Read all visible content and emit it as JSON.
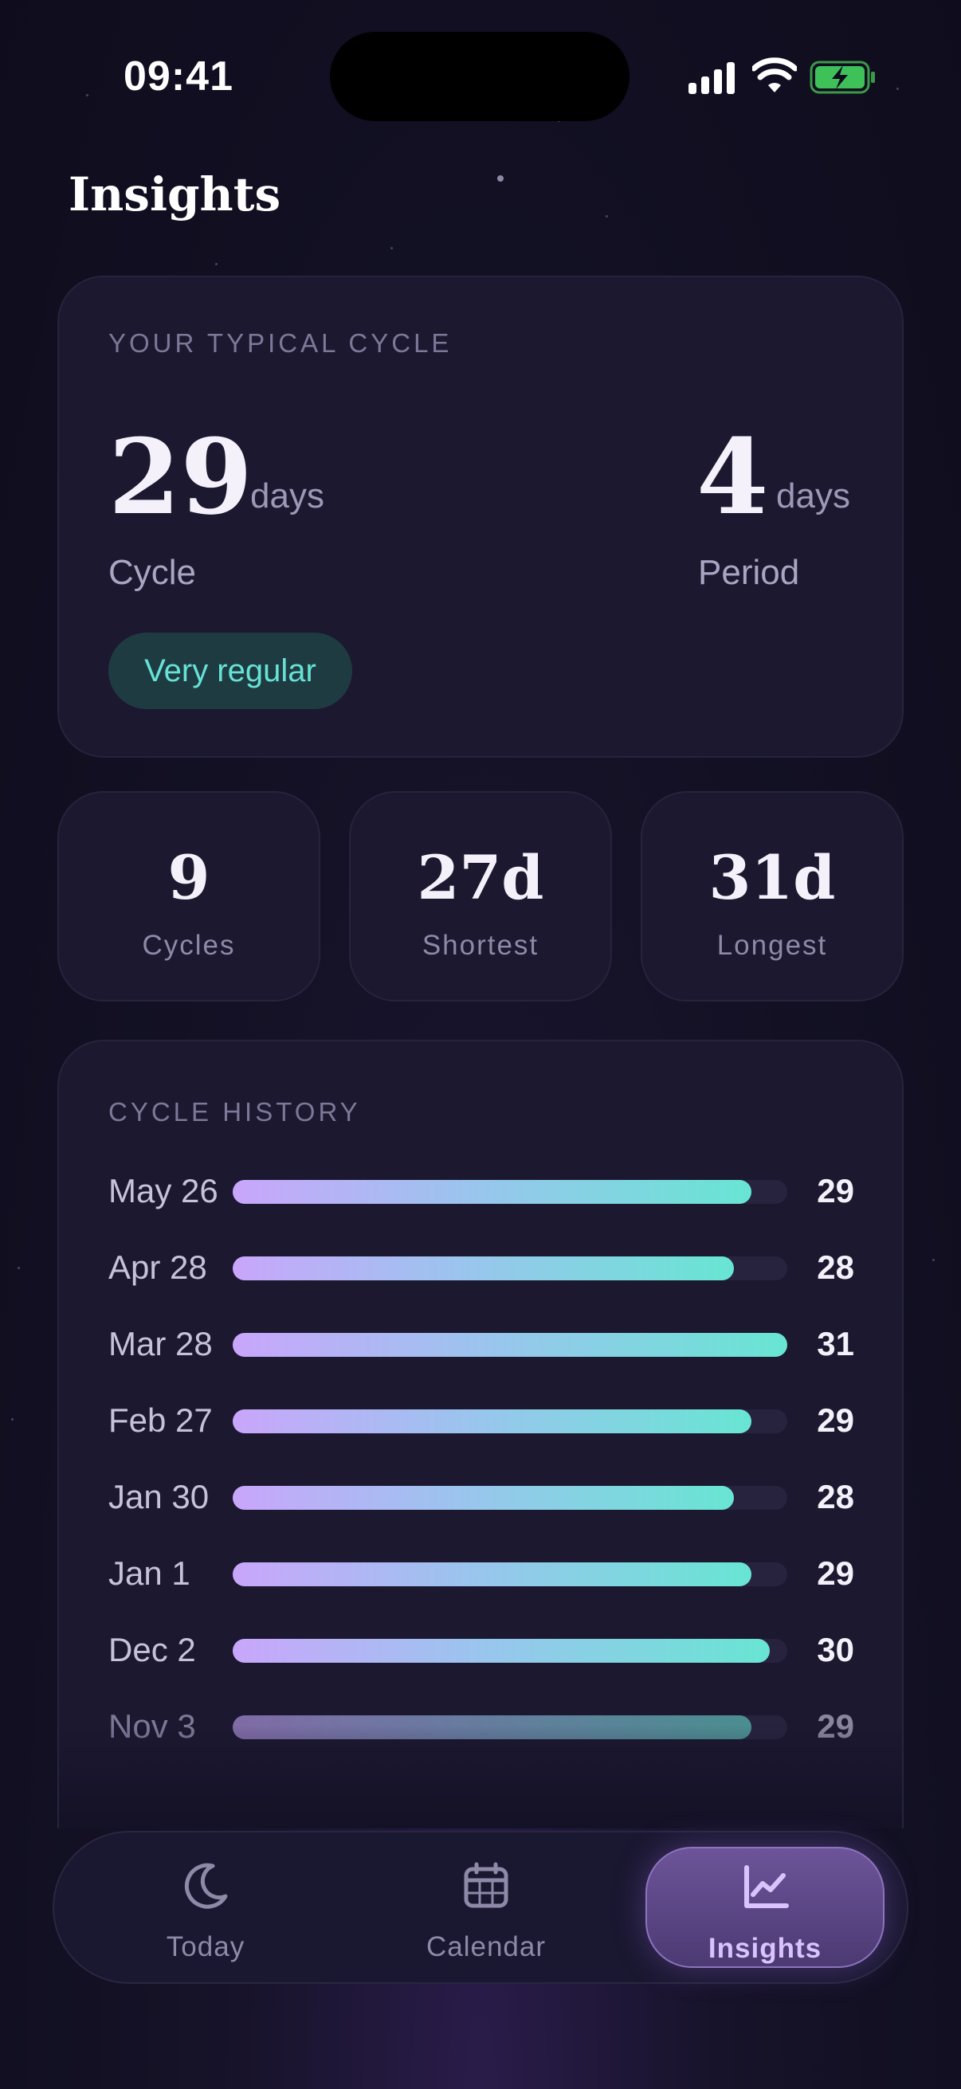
{
  "status_bar": {
    "time": "09:41"
  },
  "page": {
    "title": "Insights"
  },
  "typical_cycle": {
    "heading": "YOUR TYPICAL CYCLE",
    "cycle_value": "29",
    "cycle_unit": "days",
    "cycle_label": "Cycle",
    "period_value": "4",
    "period_unit": "days",
    "period_label": "Period",
    "regularity": "Very regular"
  },
  "stats": [
    {
      "value": "9",
      "label": "Cycles"
    },
    {
      "value": "27d",
      "label": "Shortest"
    },
    {
      "value": "31d",
      "label": "Longest"
    }
  ],
  "history": {
    "heading": "CYCLE HISTORY",
    "scale_max": 31,
    "rows": [
      {
        "date": "May 26",
        "length": "29"
      },
      {
        "date": "Apr 28",
        "length": "28"
      },
      {
        "date": "Mar 28",
        "length": "31"
      },
      {
        "date": "Feb 27",
        "length": "29"
      },
      {
        "date": "Jan 30",
        "length": "28"
      },
      {
        "date": "Jan 1",
        "length": "29"
      },
      {
        "date": "Dec 2",
        "length": "30"
      },
      {
        "date": "Nov 3",
        "length": "29"
      }
    ]
  },
  "tabs": [
    {
      "label": "Today",
      "icon": "moon-icon",
      "active": false
    },
    {
      "label": "Calendar",
      "icon": "calendar-icon",
      "active": false
    },
    {
      "label": "Insights",
      "icon": "chart-line-icon",
      "active": true
    }
  ],
  "colors": {
    "accent_teal": "#66e2d6",
    "accent_purple": "#c9a6fb",
    "background": "#110f21"
  }
}
